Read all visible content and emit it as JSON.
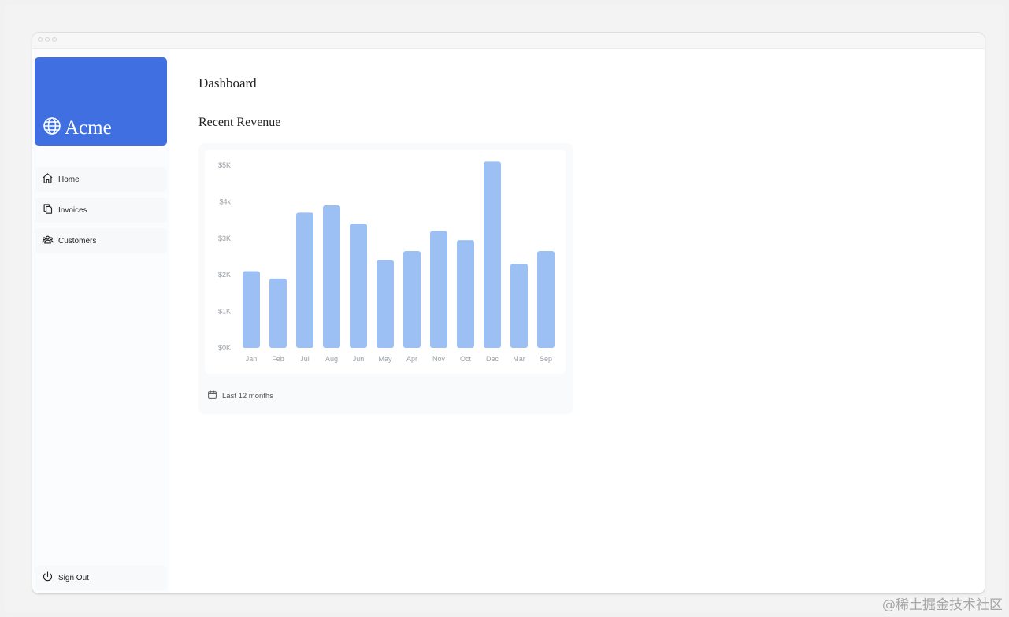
{
  "sidebar": {
    "brand": "Acme",
    "nav": [
      {
        "label": "Home",
        "icon": "home-icon"
      },
      {
        "label": "Invoices",
        "icon": "document-duplicate-icon"
      },
      {
        "label": "Customers",
        "icon": "user-group-icon"
      }
    ],
    "sign_out": "Sign Out"
  },
  "main": {
    "title": "Dashboard",
    "section_title": "Recent Revenue",
    "footer_label": "Last 12 months"
  },
  "watermark": "@稀土掘金技术社区",
  "colors": {
    "brand": "#3f6fe0",
    "bar": "#9cc0f4"
  },
  "chart_data": {
    "type": "bar",
    "categories": [
      "Jan",
      "Feb",
      "Jul",
      "Aug",
      "Jun",
      "May",
      "Apr",
      "Nov",
      "Oct",
      "Dec",
      "Mar",
      "Sep"
    ],
    "values": [
      2100,
      1900,
      3700,
      3900,
      3400,
      2400,
      2650,
      3200,
      2950,
      5100,
      2300,
      2650
    ],
    "yticks": [
      "$5K",
      "$4k",
      "$3K",
      "$2K",
      "$1K",
      "$0K"
    ],
    "ylim": [
      0,
      5000
    ],
    "xlabel": "",
    "ylabel": "",
    "grid": false
  }
}
